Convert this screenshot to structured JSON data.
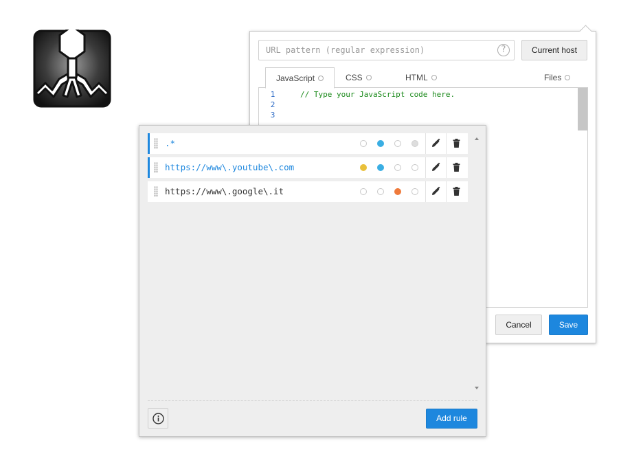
{
  "editor": {
    "url_placeholder": "URL pattern (regular expression)",
    "help_label": "?",
    "current_host_label": "Current host",
    "tabs": [
      {
        "label": "JavaScript",
        "active": true
      },
      {
        "label": "CSS",
        "active": false
      },
      {
        "label": "HTML",
        "active": false
      },
      {
        "label": "Files",
        "active": false
      }
    ],
    "line_numbers": [
      "1",
      "2",
      "3"
    ],
    "code_comment": "// Type your JavaScript code here.",
    "cancel_label": "Cancel",
    "save_label": "Save"
  },
  "rules": {
    "items": [
      {
        "pattern": ".*",
        "active": true,
        "indicators": [
          "empty",
          "blue",
          "empty",
          "gray"
        ]
      },
      {
        "pattern": "https://www\\.youtube\\.com",
        "active": true,
        "indicators": [
          "yellow",
          "blue",
          "empty",
          "empty"
        ]
      },
      {
        "pattern": "https://www\\.google\\.it",
        "active": false,
        "indicators": [
          "empty",
          "empty",
          "orange",
          "empty"
        ]
      }
    ],
    "add_rule_label": "Add rule"
  },
  "colors": {
    "accent": "#1d87de",
    "indicator_yellow": "#e9c03a",
    "indicator_blue": "#3aaee3",
    "indicator_orange": "#ef7a3b",
    "indicator_gray": "#dddddd"
  },
  "icons": {
    "logo": "bacteriophage-logo",
    "edit": "pencil-icon",
    "delete": "trash-icon",
    "info": "info-icon"
  }
}
